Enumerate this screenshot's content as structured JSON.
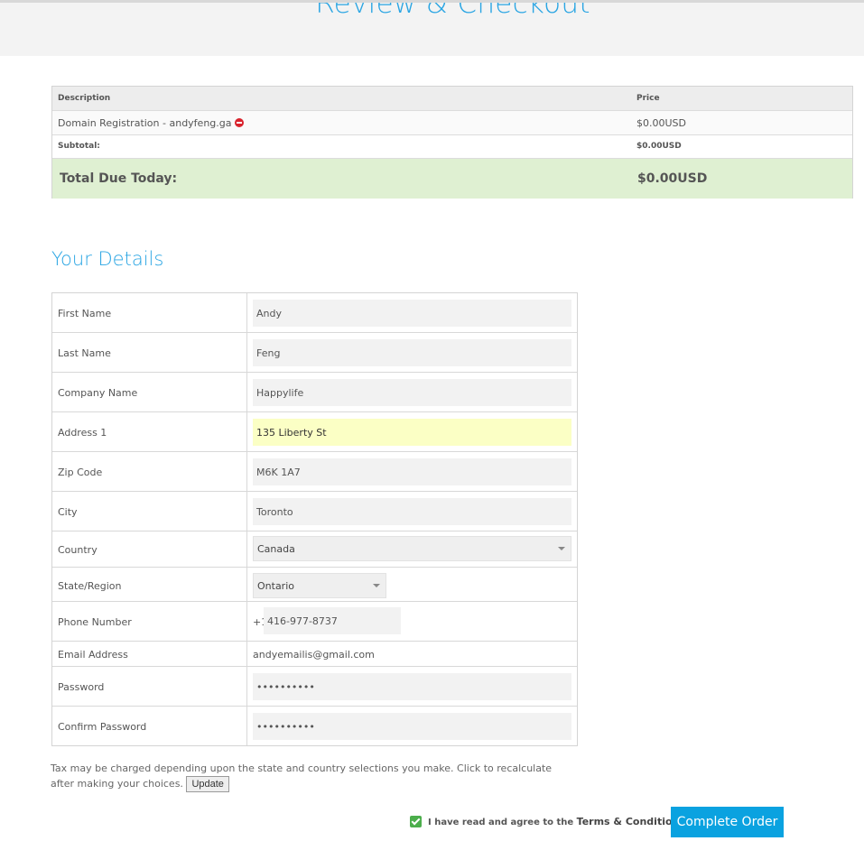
{
  "page": {
    "title": "Review & Checkout"
  },
  "order_summary": {
    "headers": {
      "description": "Description",
      "price": "Price"
    },
    "items": [
      {
        "description": "Domain Registration - andyfeng.ga",
        "price": "$0.00USD",
        "icon": "remove-icon"
      }
    ],
    "subtotal": {
      "label": "Subtotal:",
      "value": "$0.00USD"
    },
    "total": {
      "label": "Total Due Today:",
      "value": "$0.00USD"
    },
    "colors": {
      "total_bg": "#dff0d2",
      "remove_icon": "#d9232d"
    }
  },
  "details": {
    "title": "Your Details",
    "fields": {
      "first_name": {
        "label": "First Name",
        "value": "Andy"
      },
      "last_name": {
        "label": "Last Name",
        "value": "Feng"
      },
      "company_name": {
        "label": "Company Name",
        "value": "Happylife"
      },
      "address1": {
        "label": "Address 1",
        "value": "135 Liberty St"
      },
      "zip": {
        "label": "Zip Code",
        "value": "M6K 1A7"
      },
      "city": {
        "label": "City",
        "value": "Toronto"
      },
      "country": {
        "label": "Country",
        "value": "Canada"
      },
      "state": {
        "label": "State/Region",
        "value": "Ontario"
      },
      "phone": {
        "label": "Phone Number",
        "prefix": "+1",
        "value": "416-977-8737"
      },
      "email": {
        "label": "Email Address",
        "value": "andyemailis@gmail.com"
      },
      "password": {
        "label": "Password",
        "value": "••••••••••"
      },
      "confirm_password": {
        "label": "Confirm Password",
        "value": "••••••••••"
      }
    }
  },
  "tax_note": {
    "text": "Tax may be charged depending upon the state and country selections you make. Click to recalculate after making your choices.",
    "button": "Update"
  },
  "agreement": {
    "checked": true,
    "text": "I have read and agree to the",
    "link": "Terms & Conditions"
  },
  "complete_order": {
    "label": "Complete Order",
    "color": "#0aa2e0"
  },
  "accent_color": "#2aa5e3"
}
